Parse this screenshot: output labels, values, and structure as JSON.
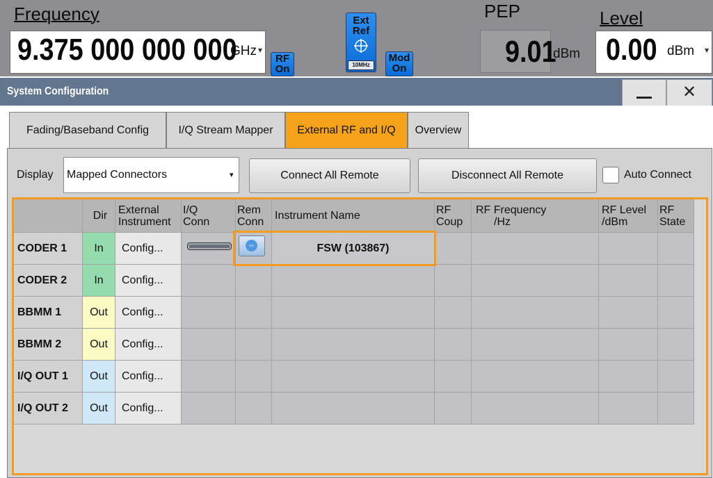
{
  "header": {
    "frequency_label": "Frequency",
    "frequency_value": "9.375 000 000 000",
    "frequency_unit": "GHz",
    "rf_button": [
      "RF",
      "On"
    ],
    "ext_ref_button": [
      "Ext",
      "Ref"
    ],
    "ext_ref_sub": "10MHz",
    "mod_button": [
      "Mod",
      "On"
    ],
    "pep_label": "PEP",
    "pep_value": "9.01",
    "pep_unit": "dBm",
    "level_label": "Level",
    "level_value": "0.00",
    "level_unit": "dBm"
  },
  "window": {
    "title": "System Configuration",
    "minimize_icon": "minimize-icon",
    "close_glyph": "✕"
  },
  "tabs": [
    {
      "label": "Fading/Baseband Config",
      "active": false
    },
    {
      "label": "I/Q Stream Mapper",
      "active": false
    },
    {
      "label": "External RF and I/Q",
      "active": true
    },
    {
      "label": "Overview",
      "active": false
    }
  ],
  "controls": {
    "display_label": "Display",
    "display_value": "Mapped Connectors",
    "connect_all": "Connect All Remote",
    "disconnect_all": "Disconnect All Remote",
    "auto_connect": "Auto Connect",
    "auto_connect_checked": false
  },
  "table": {
    "headers": [
      "",
      "Dir",
      "External Instrument",
      "I/Q Conn",
      "Rem Conn",
      "Instrument Name",
      "RF Coup",
      "RF Frequency /Hz",
      "RF Level /dBm",
      "RF State"
    ],
    "header_lines": [
      [
        ""
      ],
      [
        "Dir"
      ],
      [
        "External",
        "Instrument"
      ],
      [
        "I/Q",
        "Conn"
      ],
      [
        "Rem",
        "Conn"
      ],
      [
        "Instrument Name"
      ],
      [
        "RF",
        "Coup"
      ],
      [
        "RF Frequency",
        "/Hz"
      ],
      [
        "RF Level",
        "/dBm"
      ],
      [
        "RF",
        "State"
      ]
    ],
    "rows": [
      {
        "name": "CODER 1",
        "dir": "In",
        "config": "Config...",
        "iq_conn": true,
        "rem_conn": true,
        "instrument": "FSW (103867)"
      },
      {
        "name": "CODER 2",
        "dir": "In",
        "config": "Config...",
        "iq_conn": false,
        "rem_conn": false,
        "instrument": ""
      },
      {
        "name": "BBMM 1",
        "dir": "Out",
        "config": "Config...",
        "iq_conn": false,
        "rem_conn": false,
        "instrument": ""
      },
      {
        "name": "BBMM 2",
        "dir": "Out",
        "config": "Config...",
        "iq_conn": false,
        "rem_conn": false,
        "instrument": ""
      },
      {
        "name": "I/Q OUT 1",
        "dir": "Out",
        "config": "Config...",
        "iq_conn": false,
        "rem_conn": false,
        "instrument": ""
      },
      {
        "name": "I/Q OUT 2",
        "dir": "Out",
        "config": "Config...",
        "iq_conn": false,
        "rem_conn": false,
        "instrument": ""
      }
    ]
  },
  "colors": {
    "accent": "#f29b1e",
    "title_bar": "#62778f",
    "dir_in": "#94dcae",
    "dir_out_bbmm": "#fbfbc4",
    "dir_out_iq": "#cfe8f8"
  }
}
